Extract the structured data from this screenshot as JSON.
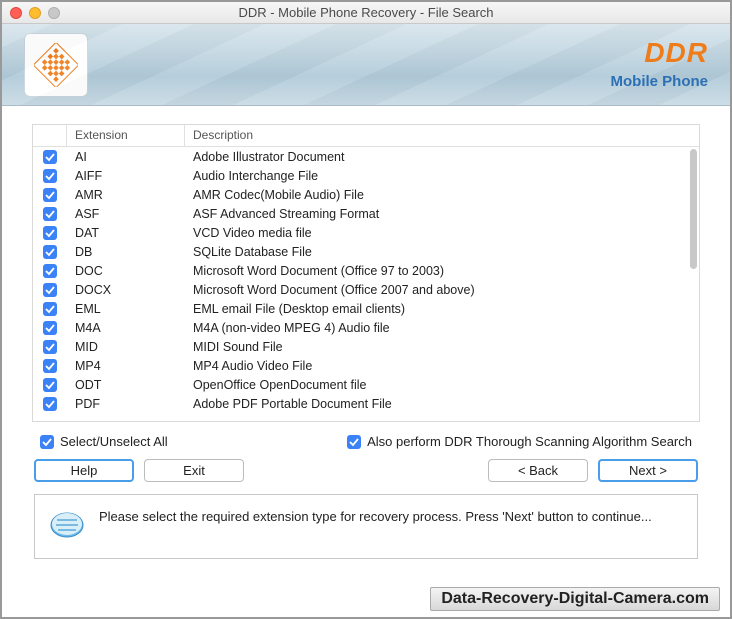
{
  "window": {
    "title": "DDR - Mobile Phone Recovery - File Search"
  },
  "brand": {
    "name": "DDR",
    "sub": "Mobile Phone"
  },
  "table": {
    "headers": {
      "extension": "Extension",
      "description": "Description"
    },
    "rows": [
      {
        "ext": "AI",
        "desc": "Adobe Illustrator Document"
      },
      {
        "ext": "AIFF",
        "desc": "Audio Interchange File"
      },
      {
        "ext": "AMR",
        "desc": "AMR Codec(Mobile Audio) File"
      },
      {
        "ext": "ASF",
        "desc": "ASF Advanced Streaming Format"
      },
      {
        "ext": "DAT",
        "desc": "VCD Video media file"
      },
      {
        "ext": "DB",
        "desc": "SQLite Database File"
      },
      {
        "ext": "DOC",
        "desc": "Microsoft Word Document (Office 97 to 2003)"
      },
      {
        "ext": "DOCX",
        "desc": "Microsoft Word Document (Office 2007 and above)"
      },
      {
        "ext": "EML",
        "desc": "EML email File (Desktop email clients)"
      },
      {
        "ext": "M4A",
        "desc": "M4A (non-video MPEG 4) Audio file"
      },
      {
        "ext": "MID",
        "desc": "MIDI Sound File"
      },
      {
        "ext": "MP4",
        "desc": "MP4 Audio Video File"
      },
      {
        "ext": "ODT",
        "desc": "OpenOffice OpenDocument file"
      },
      {
        "ext": "PDF",
        "desc": "Adobe PDF Portable Document File"
      }
    ]
  },
  "options": {
    "selectAll": "Select/Unselect All",
    "thorough": "Also perform DDR Thorough Scanning Algorithm Search"
  },
  "buttons": {
    "help": "Help",
    "exit": "Exit",
    "back": "< Back",
    "next": "Next >"
  },
  "hint": "Please select the required extension type for recovery process. Press 'Next' button to continue...",
  "watermark": "Data-Recovery-Digital-Camera.com"
}
